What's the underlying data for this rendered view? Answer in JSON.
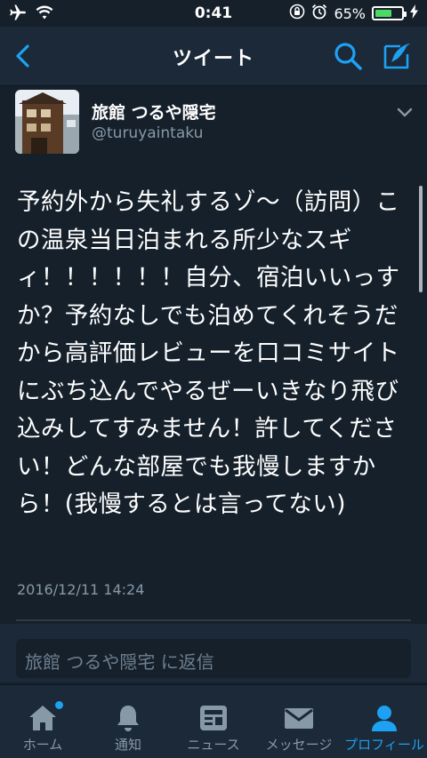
{
  "status_bar": {
    "time": "0:41",
    "battery": "65%",
    "battery_level": 0.65
  },
  "navbar": {
    "title": "ツイート"
  },
  "tweet": {
    "author_name": "旅館 つるや隠宅",
    "author_handle": "@turuyaintaku",
    "text": "予約外から失礼するゾ～（訪問）この温泉当日泊まれる所少なスギィ！！！！！！自分、宿泊いいっすか？予約なしでも泊めてくれそうだから高評価レビューを口コミサイトにぶち込んでやるぜーいきなり飛び込みしてすみません！許してください！どんな部屋でも我慢しますから！(我慢するとは言ってない)",
    "timestamp": "2016/12/11 14:24"
  },
  "reply": {
    "placeholder": "旅館 つるや隠宅 に返信"
  },
  "tabs": [
    {
      "label": "ホーム",
      "icon": "home-icon",
      "active": false,
      "badge": true
    },
    {
      "label": "通知",
      "icon": "bell-icon",
      "active": false
    },
    {
      "label": "ニュース",
      "icon": "news-icon",
      "active": false
    },
    {
      "label": "メッセージ",
      "icon": "mail-icon",
      "active": false
    },
    {
      "label": "プロフィール",
      "icon": "profile-icon",
      "active": true
    }
  ],
  "colors": {
    "accent": "#1da1f2",
    "background": "#15202b",
    "bar": "#1c2938",
    "muted": "#8899a6",
    "battery": "#4cd964"
  }
}
